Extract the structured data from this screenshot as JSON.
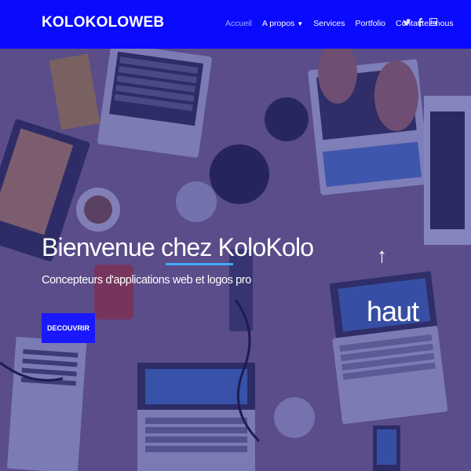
{
  "brand": {
    "name": "KOLOKOLOWEB"
  },
  "nav": {
    "items": [
      {
        "label": "Accueil",
        "active": true
      },
      {
        "label": "A propos",
        "dropdown": true
      },
      {
        "label": "Services"
      },
      {
        "label": "Portfolio"
      },
      {
        "label": "Contactez-nous"
      }
    ],
    "social": [
      "twitter-icon",
      "facebook-icon",
      "linkedin-icon"
    ]
  },
  "hero": {
    "title": "Bienvenue chez KoloKolo",
    "subtitle": "Concepteurs d'applications web et logos pro",
    "cta_label": "DECOUVRIR",
    "back_to_top_arrow": "↑",
    "back_to_top_label": "haut"
  },
  "colors": {
    "navbar": "#0a0aff",
    "cta": "#1a18ff",
    "underline": "#3fa9f5"
  }
}
